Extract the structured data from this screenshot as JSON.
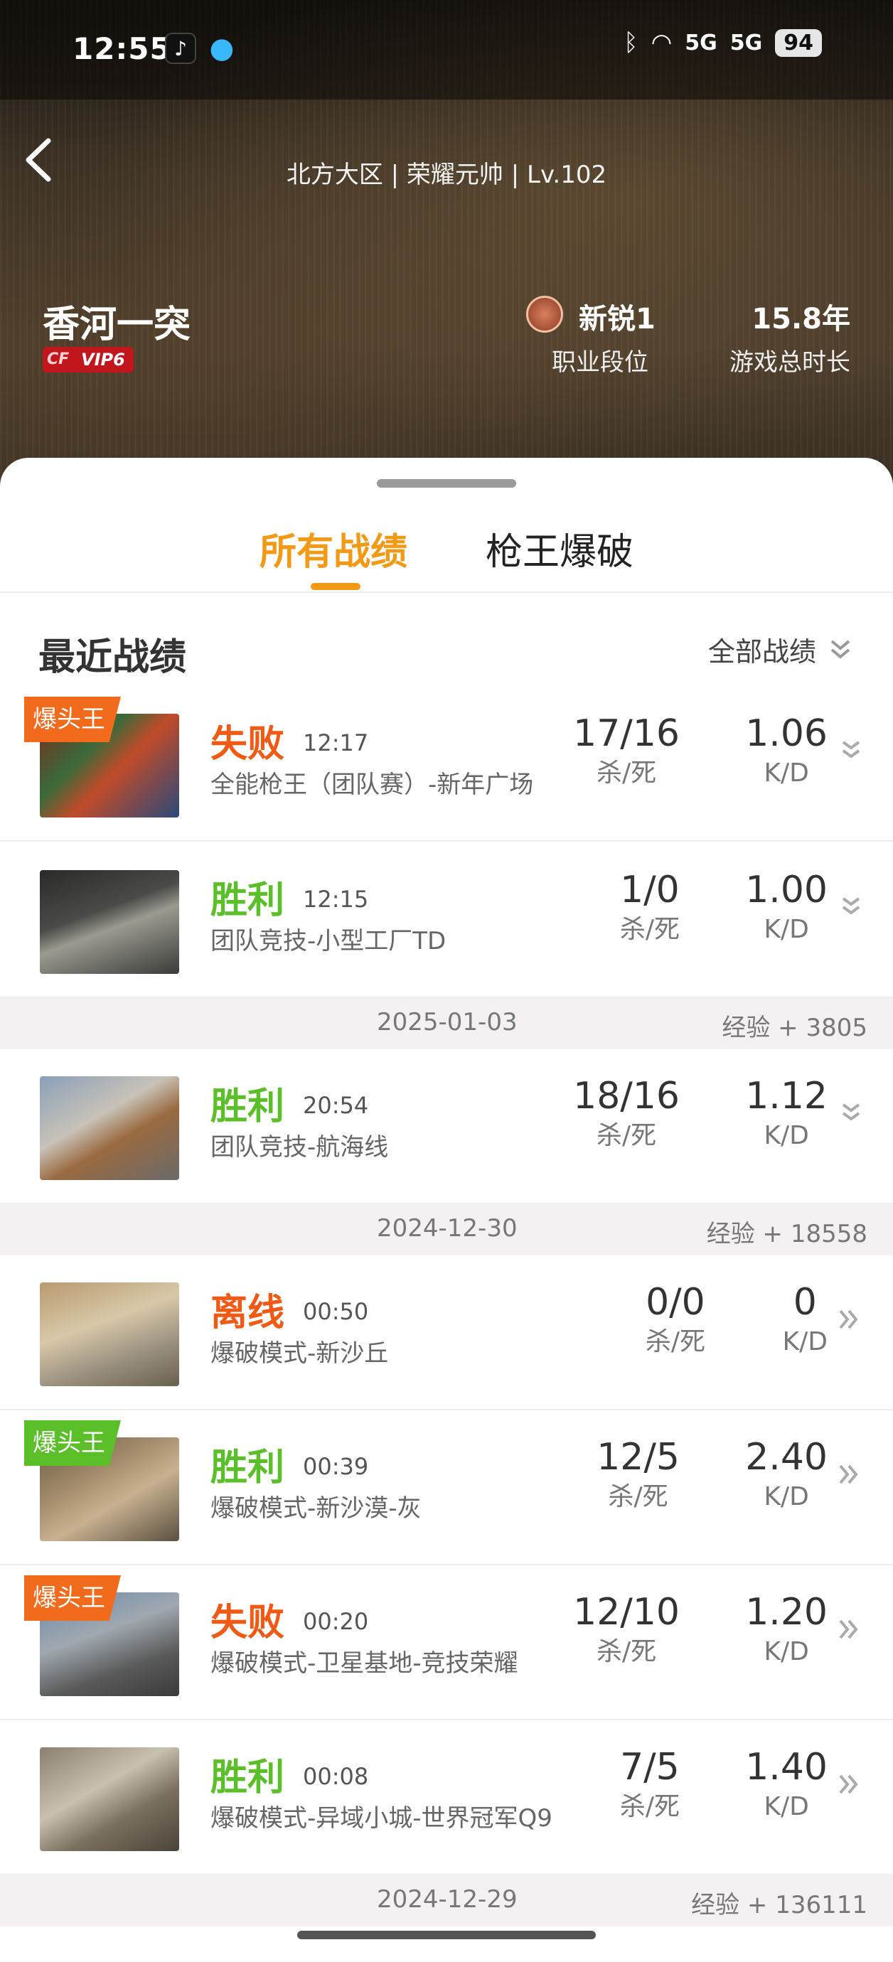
{
  "status_bar": {
    "time": "12:55",
    "signal1": "5G",
    "signal2": "5G",
    "battery": "94"
  },
  "header": {
    "server_line": "北方大区 | 荣耀元帅 | Lv.102",
    "player_name": "香河一突",
    "vip_label": "VIP6",
    "rank_value": "新锐1",
    "rank_label": "职业段位",
    "time_value": "15.8年",
    "time_label": "游戏总时长"
  },
  "tabs": [
    {
      "label": "所有战绩",
      "active": true
    },
    {
      "label": "枪王爆破",
      "active": false
    }
  ],
  "section": {
    "title": "最近战绩",
    "filter_label": "全部战绩"
  },
  "records": [
    {
      "result": "失败",
      "time": "12:17",
      "mode": "全能枪王（团队赛）-新年广场",
      "kd_count": "17/16",
      "kd_count_label": "杀/死",
      "kd_ratio": "1.06",
      "kd_ratio_label": "K/D",
      "badge": "爆头王"
    },
    {
      "result": "胜利",
      "time": "12:15",
      "mode": "团队竞技-小型工厂TD",
      "kd_count": "1/0",
      "kd_count_label": "杀/死",
      "kd_ratio": "1.00",
      "kd_ratio_label": "K/D"
    },
    {
      "result": "胜利",
      "time": "20:54",
      "mode": "团队竞技-航海线",
      "kd_count": "18/16",
      "kd_count_label": "杀/死",
      "kd_ratio": "1.12",
      "kd_ratio_label": "K/D"
    },
    {
      "result": "离线",
      "time": "00:50",
      "mode": "爆破模式-新沙丘",
      "kd_count": "0/0",
      "kd_count_label": "杀/死",
      "kd_ratio": "0",
      "kd_ratio_label": "K/D"
    },
    {
      "result": "胜利",
      "time": "00:39",
      "mode": "爆破模式-新沙漠-灰",
      "kd_count": "12/5",
      "kd_count_label": "杀/死",
      "kd_ratio": "2.40",
      "kd_ratio_label": "K/D",
      "badge": "爆头王"
    },
    {
      "result": "失败",
      "time": "00:20",
      "mode": "爆破模式-卫星基地-竞技荣耀",
      "kd_count": "12/10",
      "kd_count_label": "杀/死",
      "kd_ratio": "1.20",
      "kd_ratio_label": "K/D",
      "badge": "爆头王"
    },
    {
      "result": "胜利",
      "time": "00:08",
      "mode": "爆破模式-异域小城-世界冠军Q9",
      "kd_count": "7/5",
      "kd_count_label": "杀/死",
      "kd_ratio": "1.40",
      "kd_ratio_label": "K/D"
    }
  ],
  "date_bars": [
    {
      "date": "2025-01-03",
      "exp": "经验 + 3805"
    },
    {
      "date": "2024-12-30",
      "exp": "经验 + 18558"
    },
    {
      "date": "2024-12-29",
      "exp": "经验 + 136111"
    }
  ],
  "colors": {
    "accent": "#f29a16",
    "win": "#5bbf2a",
    "lose": "#f05a14",
    "badge_orange": "#f26a1b",
    "badge_green": "#5bbf2a"
  }
}
